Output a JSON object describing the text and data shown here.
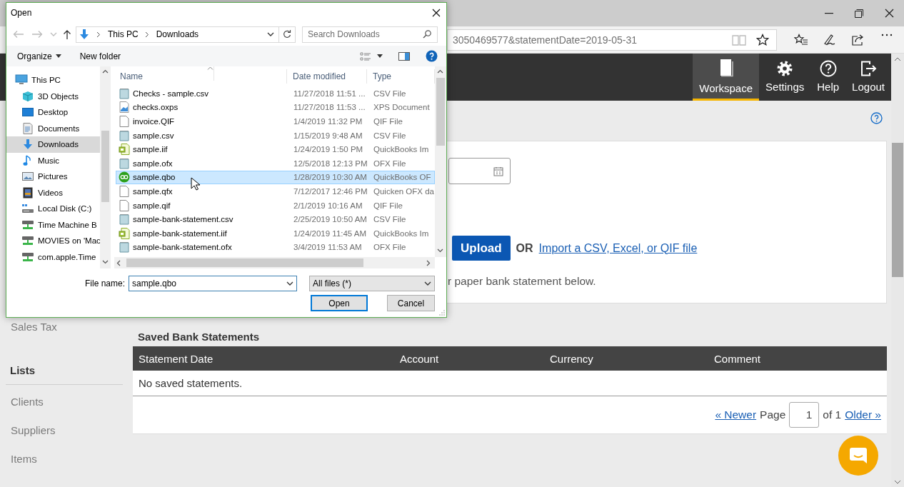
{
  "browser": {
    "address": "3050469577&statementDate=2019-05-31"
  },
  "nav": [
    {
      "label": "Workspace",
      "kind": "book",
      "selected": true
    },
    {
      "label": "Settings",
      "kind": "gear",
      "selected": false
    },
    {
      "label": "Help",
      "kind": "help",
      "selected": false
    },
    {
      "label": "Logout",
      "kind": "logout",
      "selected": false
    }
  ],
  "sidebar": {
    "items": [
      {
        "label": "Sales Tax",
        "kind": "link"
      },
      {
        "label": "Lists",
        "kind": "heading"
      },
      {
        "label": "Clients",
        "kind": "link"
      },
      {
        "label": "Suppliers",
        "kind": "link"
      },
      {
        "label": "Items",
        "kind": "link"
      }
    ]
  },
  "import": {
    "upload_button": "Upload",
    "or_label": "OR",
    "import_link": "Import a CSV, Excel, or QIF file",
    "instruction": "r paper bank statement below."
  },
  "saved": {
    "title": "Saved Bank Statements",
    "columns": [
      "Statement Date",
      "Account",
      "Currency",
      "Comment"
    ],
    "empty_message": "No saved statements.",
    "pager": {
      "newer": "« Newer",
      "page_label": "Page",
      "page": "1",
      "total": "of 1",
      "older": "Older »"
    }
  },
  "dialog": {
    "title": "Open",
    "path": [
      "This PC",
      "Downloads"
    ],
    "search_placeholder": "Search Downloads",
    "toolbar": {
      "organize": "Organize",
      "new_folder": "New folder"
    },
    "tree": [
      {
        "label": "This PC",
        "kind": "pc",
        "selected": false,
        "children": [
          {
            "label": "3D Objects",
            "kind": "cube",
            "selected": false
          },
          {
            "label": "Desktop",
            "kind": "desktop",
            "selected": false
          },
          {
            "label": "Documents",
            "kind": "documents",
            "selected": false
          },
          {
            "label": "Downloads",
            "kind": "downloads",
            "selected": true
          },
          {
            "label": "Music",
            "kind": "music",
            "selected": false
          },
          {
            "label": "Pictures",
            "kind": "pictures",
            "selected": false
          },
          {
            "label": "Videos",
            "kind": "videos",
            "selected": false
          },
          {
            "label": "Local Disk (C:)",
            "kind": "disk",
            "selected": false
          },
          {
            "label": "Time Machine B",
            "kind": "network",
            "selected": false
          },
          {
            "label": "MOVIES on 'Mac",
            "kind": "network",
            "selected": false
          },
          {
            "label": "com.apple.Time",
            "kind": "network",
            "selected": false
          }
        ]
      }
    ],
    "columns": [
      "Name",
      "Date modified",
      "Type"
    ],
    "files": [
      {
        "name": "Checks - sample.csv",
        "date": "11/27/2018 11:51 ...",
        "type": "CSV File",
        "kind": "csv",
        "selected": false
      },
      {
        "name": "checks.oxps",
        "date": "11/27/2018 11:53 ...",
        "type": "XPS Document",
        "kind": "xps",
        "selected": false
      },
      {
        "name": "invoice.QIF",
        "date": "1/4/2019 11:32 PM",
        "type": "QIF File",
        "kind": "blank",
        "selected": false
      },
      {
        "name": "sample.csv",
        "date": "1/15/2019 9:48 AM",
        "type": "CSV File",
        "kind": "csv",
        "selected": false
      },
      {
        "name": "sample.iif",
        "date": "1/24/2019 1:50 PM",
        "type": "QuickBooks Im",
        "kind": "iif",
        "selected": false
      },
      {
        "name": "sample.ofx",
        "date": "12/5/2018 12:13 PM",
        "type": "OFX File",
        "kind": "csv",
        "selected": false
      },
      {
        "name": "sample.qbo",
        "date": "1/28/2019 10:30 AM",
        "type": "QuickBooks OF",
        "kind": "qbo",
        "selected": true
      },
      {
        "name": "sample.qfx",
        "date": "7/12/2017 12:46 PM",
        "type": "Quicken OFX da",
        "kind": "blank",
        "selected": false
      },
      {
        "name": "sample.qif",
        "date": "2/1/2019 10:16 AM",
        "type": "QIF File",
        "kind": "blank",
        "selected": false
      },
      {
        "name": "sample-bank-statement.csv",
        "date": "2/25/2019 10:50 AM",
        "type": "CSV File",
        "kind": "csv",
        "selected": false
      },
      {
        "name": "sample-bank-statement.iif",
        "date": "1/24/2019 11:45 AM",
        "type": "QuickBooks Im",
        "kind": "iif",
        "selected": false
      },
      {
        "name": "sample-bank-statement.ofx",
        "date": "3/4/2019 11:53 AM",
        "type": "OFX File",
        "kind": "csv",
        "selected": false
      }
    ],
    "file_name_label": "File name:",
    "file_name": "sample.qbo",
    "filter": "All files (*)",
    "buttons": [
      "Open",
      "Cancel"
    ]
  }
}
